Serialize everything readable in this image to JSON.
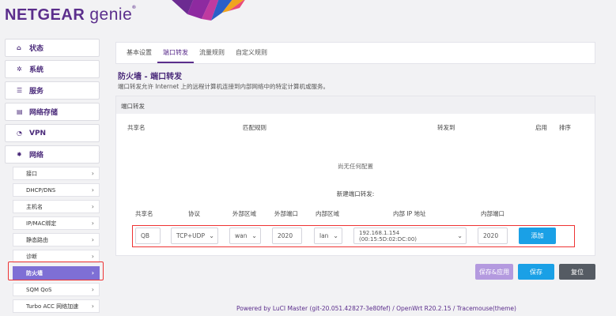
{
  "brand": {
    "name": "NETGEAR",
    "product": "genie",
    "mark": "®"
  },
  "sidebar": {
    "main": [
      {
        "icon": "home-icon",
        "glyph": "⌂",
        "label": "状态"
      },
      {
        "icon": "gear-icon",
        "glyph": "✲",
        "label": "系统"
      },
      {
        "icon": "list-icon",
        "glyph": "☰",
        "label": "服务"
      },
      {
        "icon": "storage-icon",
        "glyph": "▤",
        "label": "网络存储"
      },
      {
        "icon": "speed-icon",
        "glyph": "◔",
        "label": "VPN"
      },
      {
        "icon": "network-icon",
        "glyph": "✸",
        "label": "网络"
      }
    ],
    "sub": [
      {
        "label": "接口"
      },
      {
        "label": "DHCP/DNS"
      },
      {
        "label": "主机名"
      },
      {
        "label": "IP/MAC绑定"
      },
      {
        "label": "静态路由"
      },
      {
        "label": "诊断"
      },
      {
        "label": "防火墙"
      },
      {
        "label": "SQM QoS"
      },
      {
        "label": "Turbo ACC 网络加速"
      }
    ],
    "chevron": "›"
  },
  "tabs": [
    {
      "label": "基本设置"
    },
    {
      "label": "端口转发"
    },
    {
      "label": "流量规则"
    },
    {
      "label": "自定义规则"
    }
  ],
  "page": {
    "title": "防火墙 - 端口转发",
    "description": "端口转发允许 Internet 上的远程计算机连接到内部网络中的特定计算机或服务。"
  },
  "table": {
    "section_title": "端口转发",
    "columns": [
      "共享名",
      "匹配规则",
      "转发到",
      "启用",
      "排序"
    ],
    "empty_note": "尚无任何配置"
  },
  "new_forward": {
    "title": "新建端口转发:",
    "columns": [
      "共享名",
      "协议",
      "外部区域",
      "外部端口",
      "内部区域",
      "内部 IP 地址",
      "内部端口"
    ],
    "values": {
      "name": "QB",
      "protocol": "TCP+UDP",
      "ext_zone": "wan",
      "ext_port": "2020",
      "int_zone": "lan",
      "int_ip": "192.168.1.154 (00:15:5D:02:DC:00)",
      "int_port": "2020"
    },
    "add_label": "添加",
    "caret": "⌄"
  },
  "actions": {
    "save_apply": "保存&应用",
    "save": "保存",
    "reset": "复位"
  },
  "footer": "Powered by LuCI Master (git-20.051.42827-3e80fef) / OpenWrt R20.2.15 / Tracemouse(theme)",
  "colors": {
    "brand": "#5b2e8c",
    "accent": "#1aa0e6",
    "active_nav": "#7e6fd5",
    "highlight": "#e33333"
  }
}
